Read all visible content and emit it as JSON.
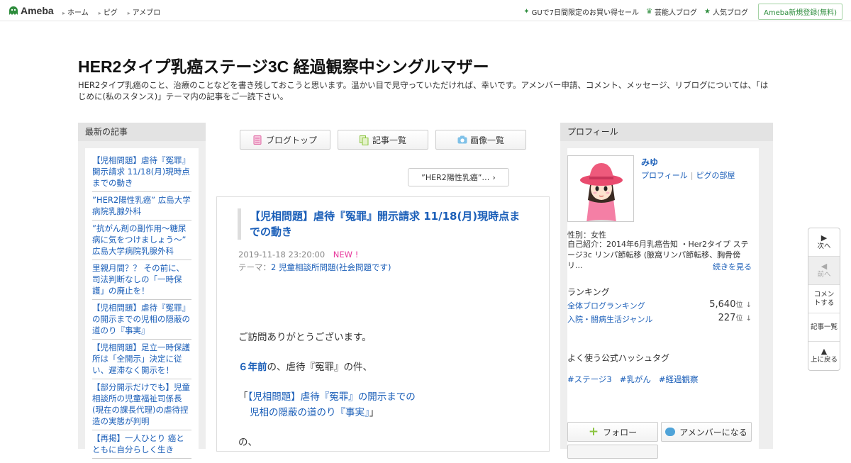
{
  "header": {
    "logo_text": "Ameba",
    "nav": [
      "ホーム",
      "ピグ",
      "アメブロ"
    ],
    "right_links": [
      {
        "icon": "sparkle-icon",
        "label": "GUで7日間限定のお買い得セール"
      },
      {
        "icon": "crown-icon",
        "label": "芸能人ブログ"
      },
      {
        "icon": "star-icon",
        "label": "人気ブログ"
      }
    ],
    "register_label": "Ameba新規登録(無料)"
  },
  "blog": {
    "title": "HER2タイプ乳癌ステージ3C 経過観察中シングルマザー",
    "description": "HER2タイプ乳癌のこと、治療のことなどを書き残しておこうと思います。温かい目で見守っていただければ、幸いです。アメンバー申請、コメント、メッセージ、リブログについては、「はじめに(私のスタンス)」テーマ内の記事をご一読下さい。"
  },
  "recent": {
    "heading": "最新の記事",
    "items": [
      "【児相問題】虐待『冤罪』開示請求 11/18(月)現時点までの動き",
      "”HER2陽性乳癌” 広島大学病院乳腺外科",
      "”抗がん剤の副作用～糖尿病に気をつけましょう～” 広島大学病院乳腺外科",
      "里親月間？？ その前に、司法判断なしの「一時保護」の廃止を！",
      "【児相問題】虐待『冤罪』の開示までの児相の隠蔽の道のり『事実』",
      "【児相問題】足立一時保護所は「全開示」決定に従い、遅滞なく開示を！",
      "【部分開示だけでも】児童相談所の児童福祉司係長(現在の課長代理)の虐待捏造の実態が判明",
      "【再掲】一人ひとり 癌とともに自分らしく生き"
    ]
  },
  "tabs": {
    "blog_top": "ブログトップ",
    "article_list": "記事一覧",
    "image_list": "画像一覧"
  },
  "theme_link": "”HER2陽性乳癌”…",
  "article": {
    "title": "【児相問題】虐待『冤罪』開示請求 11/18(月)現時点までの動き",
    "date": "2019-11-18 23:20:00",
    "new_badge": "NEW !",
    "theme_label": "テーマ：",
    "theme_name": "2 児童相談所問題(社会問題です)",
    "line1": "ご訪問ありがとうございます。",
    "line2_bold": "６年前",
    "line2_rest": "の、虐待『冤罪』の件、",
    "quote_open": "「",
    "quote_line1": "【児相問題】虐待『冤罪』の開示までの",
    "quote_line2": "児相の隠蔽の道のり『事実』",
    "quote_close": "」",
    "line4": "の、"
  },
  "profile": {
    "heading": "プロフィール",
    "name": "みゆ",
    "link1": "プロフィール",
    "link2": "ピグの部屋",
    "gender": "性別：女性",
    "intro": "自己紹介：2014年6月乳癌告知 ・Her2タイプ ステージ3c リンパ節転移 (腋窩リンパ節転移、胸骨傍リ...",
    "more": "続きを見る",
    "ranking_heading": "ランキング",
    "rankings": [
      {
        "name": "全体ブログランキング",
        "value": "5,640",
        "unit": "位",
        "trend": "↓"
      },
      {
        "name": "入院・闘病生活ジャンル",
        "value": "227",
        "unit": "位",
        "trend": "↓"
      }
    ],
    "hashtag_heading": "よく使う公式ハッシュタグ",
    "hashtags": [
      "#ステージ3",
      "#乳がん",
      "#経過観察"
    ],
    "follow_label": "フォロー",
    "amember_label": "アメンバーになる"
  },
  "sidenav": {
    "next": "次へ",
    "prev": "前へ",
    "comment": "コメントする",
    "list": "記事一覧",
    "top": "上に戻る"
  }
}
